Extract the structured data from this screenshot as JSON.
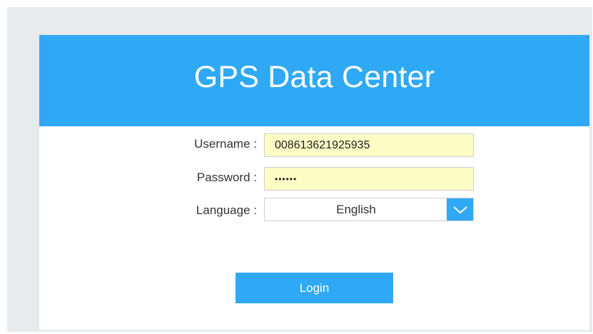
{
  "header": {
    "title": "GPS Data Center"
  },
  "form": {
    "username_label": "Username :",
    "username_value": "008613621925935",
    "password_label": "Password :",
    "password_value": "••••••",
    "language_label": "Language :",
    "language_value": "English",
    "login_label": "Login"
  },
  "icons": {
    "language_dropdown": "chevron-down-icon"
  },
  "colors": {
    "accent": "#2fa9f5",
    "input_bg": "#fdfdc6",
    "frame_bg": "#e8ebee"
  }
}
